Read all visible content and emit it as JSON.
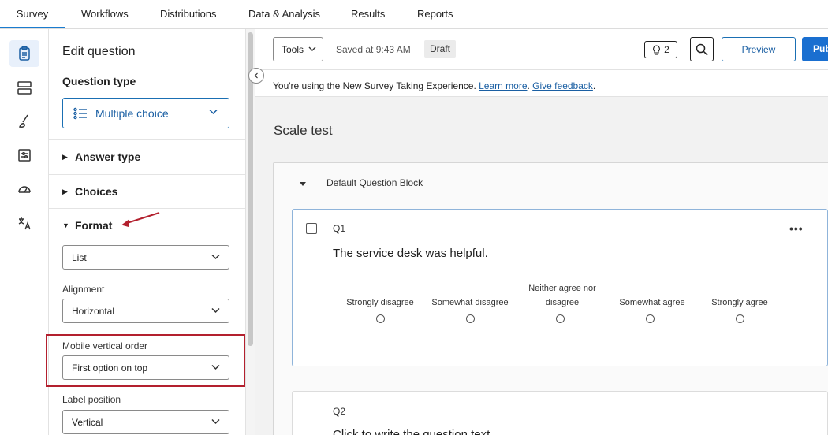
{
  "top_nav": {
    "tabs": [
      "Survey",
      "Workflows",
      "Distributions",
      "Data & Analysis",
      "Results",
      "Reports"
    ],
    "active": "Survey"
  },
  "rail": {
    "icons": [
      "survey-icon",
      "survey-flow-icon",
      "look-and-feel-icon",
      "survey-options-icon",
      "tools-gauge-icon",
      "translate-icon"
    ]
  },
  "panel": {
    "title": "Edit question",
    "question_type_heading": "Question type",
    "question_type_value": "Multiple choice",
    "sections": {
      "answer_type": "Answer type",
      "choices": "Choices",
      "format": "Format"
    },
    "format_select_value": "List",
    "alignment_label": "Alignment",
    "alignment_value": "Horizontal",
    "mobile_order_label": "Mobile vertical order",
    "mobile_order_value": "First option on top",
    "label_position_label": "Label position",
    "label_position_value": "Vertical"
  },
  "toolbar": {
    "tools_label": "Tools",
    "saved_text": "Saved at 9:43 AM",
    "draft_badge": "Draft",
    "ideas_count": "2",
    "preview_label": "Preview",
    "publish_label": "Publish"
  },
  "notice": {
    "text": "You're using the New Survey Taking Experience.",
    "learn_more": "Learn more",
    "give_feedback": "Give feedback"
  },
  "survey": {
    "title": "Scale test",
    "block_title": "Default Question Block",
    "q1": {
      "number": "Q1",
      "text": "The service desk was helpful.",
      "options": [
        "Strongly disagree",
        "Somewhat disagree",
        "Neither agree nor disagree",
        "Somewhat agree",
        "Strongly agree"
      ]
    },
    "q2": {
      "number": "Q2",
      "text": "Click to write the question text"
    }
  },
  "colors": {
    "accent": "#1a6fd0",
    "highlight": "#b3202e"
  }
}
